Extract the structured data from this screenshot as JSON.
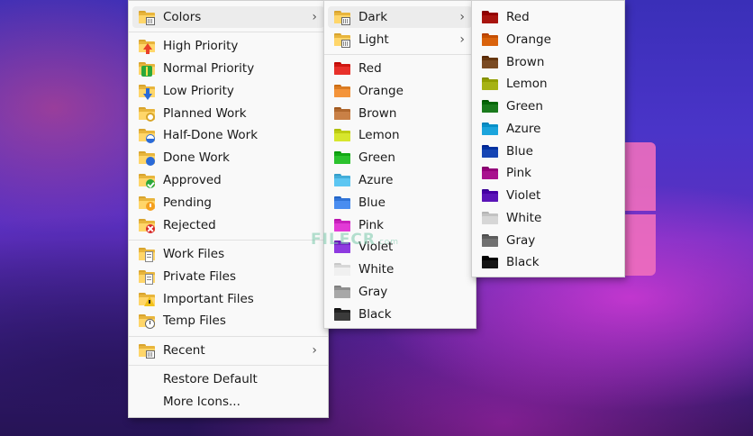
{
  "menu1": {
    "items": [
      {
        "label": "Colors",
        "submenu": true,
        "icon": "colors-folder-icon"
      },
      {
        "label": "High Priority",
        "icon": "high-priority-folder-icon"
      },
      {
        "label": "Normal Priority",
        "icon": "normal-priority-folder-icon"
      },
      {
        "label": "Low Priority",
        "icon": "low-priority-folder-icon"
      },
      {
        "label": "Planned Work",
        "icon": "planned-work-folder-icon"
      },
      {
        "label": "Half-Done Work",
        "icon": "half-done-work-folder-icon"
      },
      {
        "label": "Done Work",
        "icon": "done-work-folder-icon"
      },
      {
        "label": "Approved",
        "icon": "approved-folder-icon"
      },
      {
        "label": "Pending",
        "icon": "pending-folder-icon"
      },
      {
        "label": "Rejected",
        "icon": "rejected-folder-icon"
      },
      {
        "label": "Work Files",
        "icon": "work-files-folder-icon"
      },
      {
        "label": "Private Files",
        "icon": "private-files-folder-icon"
      },
      {
        "label": "Important Files",
        "icon": "important-files-folder-icon"
      },
      {
        "label": "Temp Files",
        "icon": "temp-files-folder-icon"
      },
      {
        "label": "Recent",
        "submenu": true,
        "icon": "recent-folder-icon"
      },
      {
        "label": "Restore Default"
      },
      {
        "label": "More Icons..."
      }
    ]
  },
  "menu2": {
    "items": [
      {
        "label": "Dark",
        "submenu": true
      },
      {
        "label": "Light",
        "submenu": true
      },
      {
        "label": "Red",
        "color": "#e8302a"
      },
      {
        "label": "Orange",
        "color": "#f4943a"
      },
      {
        "label": "Brown",
        "color": "#c98046"
      },
      {
        "label": "Lemon",
        "color": "#d7e62c"
      },
      {
        "label": "Green",
        "color": "#2cc22e"
      },
      {
        "label": "Azure",
        "color": "#5cc6f2"
      },
      {
        "label": "Blue",
        "color": "#4a8df0"
      },
      {
        "label": "Pink",
        "color": "#e23ad6"
      },
      {
        "label": "Violet",
        "color": "#8e3ae0"
      },
      {
        "label": "White",
        "color": "#f0f0f0"
      },
      {
        "label": "Gray",
        "color": "#a8a8a8"
      },
      {
        "label": "Black",
        "color": "#3a3a3a"
      }
    ]
  },
  "menu3": {
    "items": [
      {
        "label": "Red",
        "color": "#a8140e"
      },
      {
        "label": "Orange",
        "color": "#d9620c"
      },
      {
        "label": "Brown",
        "color": "#7a4a22"
      },
      {
        "label": "Lemon",
        "color": "#a6b214"
      },
      {
        "label": "Green",
        "color": "#1a7a1c"
      },
      {
        "label": "Azure",
        "color": "#1ba4dc"
      },
      {
        "label": "Blue",
        "color": "#1645b4"
      },
      {
        "label": "Pink",
        "color": "#a8128e"
      },
      {
        "label": "Violet",
        "color": "#5a14b8"
      },
      {
        "label": "White",
        "color": "#d6d6d6"
      },
      {
        "label": "Gray",
        "color": "#707070"
      },
      {
        "label": "Black",
        "color": "#151515"
      }
    ]
  },
  "watermark": "FILECR",
  "watermark_sub": ".com"
}
